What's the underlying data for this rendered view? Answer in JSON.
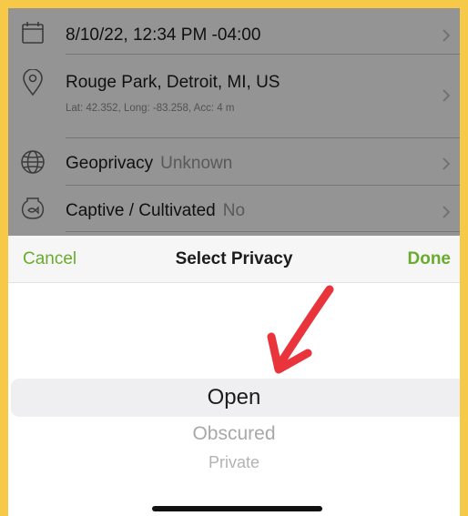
{
  "observation": {
    "date_label": "8/10/22, 12:34 PM -04:00",
    "location_label": "Rouge Park, Detroit, MI, US",
    "location_sub": "Lat: 42.352, Long: -83.258, Acc: 4 m",
    "geoprivacy_label": "Geoprivacy",
    "geoprivacy_value": "Unknown",
    "captive_label": "Captive / Cultivated",
    "captive_value": "No"
  },
  "sheet": {
    "cancel_label": "Cancel",
    "title": "Select Privacy",
    "done_label": "Done"
  },
  "picker": {
    "options": [
      "Open",
      "Obscured",
      "Private"
    ],
    "selected": "Open"
  },
  "colors": {
    "accent": "#6aab2e",
    "frame": "#f7c948",
    "annotation": "#e8343a"
  },
  "icons": [
    "calendar-icon",
    "map-pin-icon",
    "globe-icon",
    "fishbowl-icon",
    "chevron-right-icon",
    "annotation-arrow"
  ]
}
